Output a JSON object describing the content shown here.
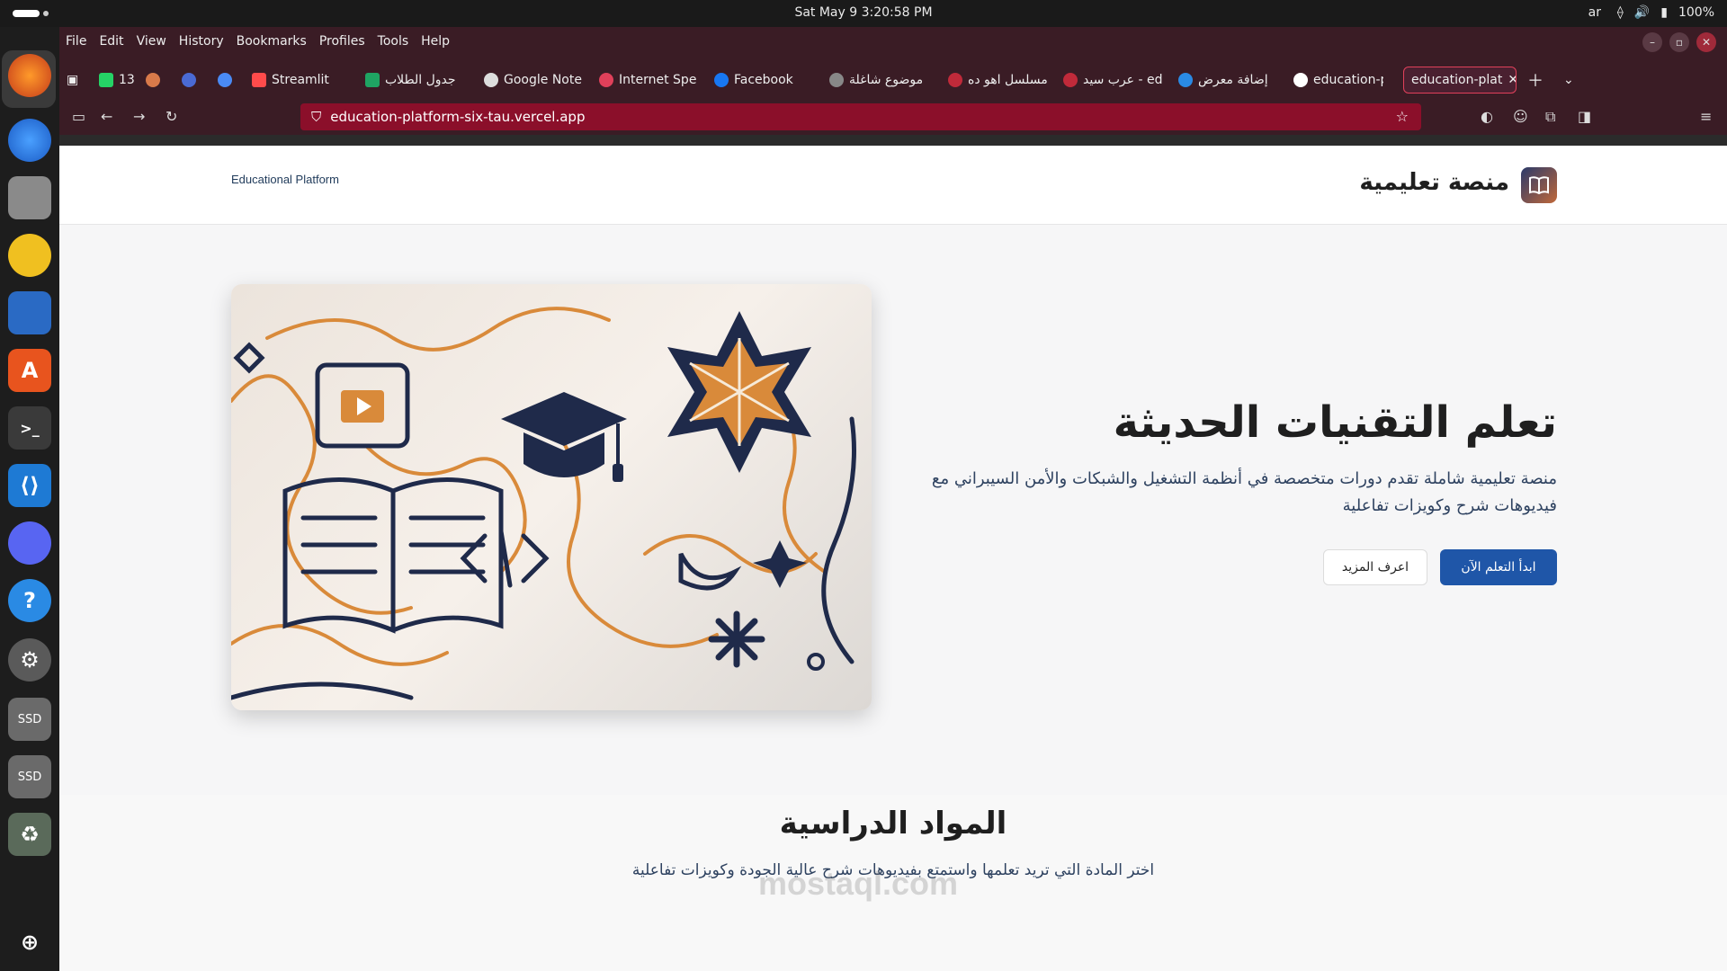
{
  "system": {
    "clock": "Sat May 9     3:20:58 PM",
    "lang": "ar",
    "battery": "100%"
  },
  "browser": {
    "menu": [
      "File",
      "Edit",
      "View",
      "History",
      "Bookmarks",
      "Profiles",
      "Tools",
      "Help"
    ],
    "tabs": [
      {
        "label": "",
        "icon": "whatsapp-icon",
        "badge": "13"
      },
      {
        "label": "",
        "icon": "claude-icon"
      },
      {
        "label": "",
        "icon": "bird-icon"
      },
      {
        "label": "",
        "icon": "gemini-icon"
      },
      {
        "label": "Streamlit",
        "icon": "streamlit-icon"
      },
      {
        "label": "جدول الطلاب",
        "icon": "sheets-icon"
      },
      {
        "label": "Google Note",
        "icon": "notebook-icon"
      },
      {
        "label": "Internet Spe",
        "icon": "speed-icon"
      },
      {
        "label": "Facebook",
        "icon": "facebook-icon"
      },
      {
        "label": "موضوع شاغلة",
        "icon": "chatgpt-icon"
      },
      {
        "label": "مسلسل اهو ده",
        "icon": "pin-icon"
      },
      {
        "label": "عرب سيد - ed",
        "icon": "pin-icon"
      },
      {
        "label": "إضافة معرض",
        "icon": "circle-icon"
      },
      {
        "label": "education-pl",
        "icon": "vercel-icon"
      },
      {
        "label": "education-plat",
        "icon": "vercel-icon",
        "active": true
      }
    ],
    "url": "education-platform-six-tau.vercel.app"
  },
  "site": {
    "brand_en": "Educational Platform",
    "brand_ar": "منصة تعليمية",
    "hero_title": "تعلم التقنيات الحديثة",
    "hero_desc": "منصة تعليمية شاملة تقدم دورات متخصصة في أنظمة التشغيل والشبكات والأمن السيبراني مع فيديوهات شرح وكويزات تفاعلية",
    "btn_primary": "ابدأ التعلم الآن",
    "btn_secondary": "اعرف المزيد",
    "section_title": "المواد الدراسية",
    "section_sub": "اختر المادة التي تريد تعلمها واستمتع بفيديوهات شرح عالية الجودة وكويزات تفاعلية",
    "watermark": "mostaql.com"
  },
  "colors": {
    "browser_chrome": "#3a1c25",
    "url_bar": "#8b0f2a",
    "primary_button": "#1f56a8",
    "illustration_navy": "#1f2a4a",
    "illustration_orange": "#d98a3a"
  }
}
